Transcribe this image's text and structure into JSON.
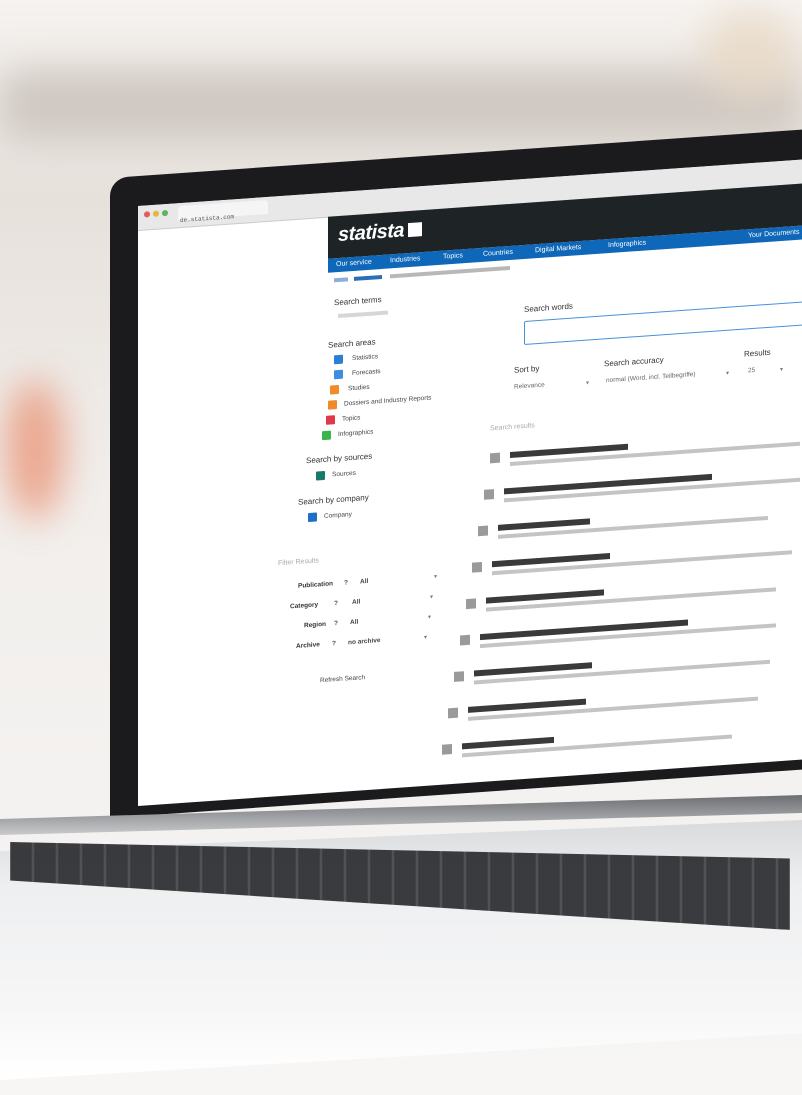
{
  "browser": {
    "address": "de.statista.com"
  },
  "brand": {
    "logo": "statista",
    "accent": "#0e67b8",
    "header_bg": "#1e2326"
  },
  "nav": {
    "items": [
      "Our service",
      "Industries",
      "Topics",
      "Countries",
      "Digital Markets",
      "Infographics"
    ],
    "right": "Your Documents"
  },
  "sidebar": {
    "search_terms_label": "Search terms",
    "search_areas_label": "Search areas",
    "areas": [
      {
        "label": "Statistics",
        "icon": "bar-chart-icon",
        "color": "#2a7fd4"
      },
      {
        "label": "Forecasts",
        "icon": "forecast-chart-icon",
        "color": "#3e8ee0"
      },
      {
        "label": "Studies",
        "icon": "study-document-icon",
        "color": "#f08a2a"
      },
      {
        "label": "Dossiers and Industry Reports",
        "icon": "dossier-icon",
        "color": "#f08a2a"
      },
      {
        "label": "Topics",
        "icon": "topic-icon",
        "color": "#e0384a"
      },
      {
        "label": "Infographics",
        "icon": "infographic-icon",
        "color": "#3bb54a"
      }
    ],
    "sources_label": "Search by sources",
    "sources_item": {
      "label": "Sources",
      "icon": "source-icon",
      "color": "#1a7a6a"
    },
    "company_label": "Search by company",
    "company_item": {
      "label": "Company",
      "icon": "company-icon",
      "color": "#1f6fc4"
    },
    "filters_label": "Filter Results",
    "filters": [
      {
        "label": "Publication",
        "value": "All"
      },
      {
        "label": "Category",
        "value": "All"
      },
      {
        "label": "Region",
        "value": "All"
      },
      {
        "label": "Archive",
        "value": "no archive"
      }
    ],
    "refresh_label": "Refresh Search"
  },
  "main": {
    "search_words_label": "Search words",
    "sort_by_label": "Sort by",
    "sort_by_value": "Relevance",
    "accuracy_label": "Search accuracy",
    "accuracy_value": "normal (Word, incl. Teilbegriffe)",
    "results_label": "Results",
    "results_value": "25",
    "results_heading": "Search results"
  }
}
